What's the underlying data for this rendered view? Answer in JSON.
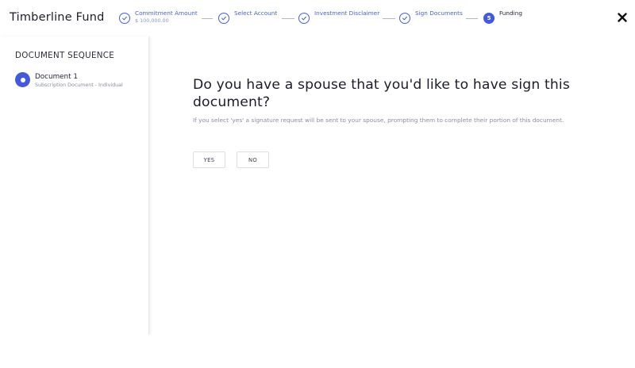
{
  "header": {
    "fund_title": "Timberline Fund",
    "close_icon": "close-icon"
  },
  "steps": [
    {
      "label": "Commitment Amount",
      "sub": "$ 100,000.00",
      "status": "complete"
    },
    {
      "label": "Select Account",
      "status": "complete"
    },
    {
      "label": "Investment Disclaimer",
      "status": "complete"
    },
    {
      "label": "Sign Documents",
      "status": "complete"
    },
    {
      "label": "Funding",
      "number": "5",
      "status": "current"
    }
  ],
  "sidebar": {
    "title": "DOCUMENT SEQUENCE",
    "documents": [
      {
        "name": "Document 1",
        "subtitle": "Subscription Document - Individual"
      }
    ]
  },
  "main": {
    "question": "Do you have a spouse that you'd like to have sign this document?",
    "description": "If you select 'yes' a signature request will be sent to your spouse, prompting them to complete their portion of this document.",
    "yes_label": "YES",
    "no_label": "NO"
  },
  "colors": {
    "accent": "#4659d6",
    "step_text": "#4a5fd0",
    "muted_text": "#8a8d9c"
  }
}
